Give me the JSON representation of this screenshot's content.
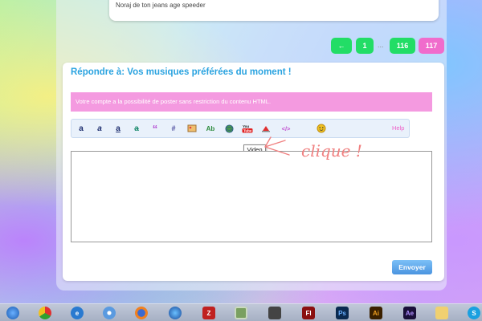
{
  "previous_post": {
    "text": "Noraj de ton jeans age speeder"
  },
  "pagination": {
    "prev_label": "←",
    "first_label": "1",
    "ellipsis": "...",
    "page_116": "116",
    "current_page": "117"
  },
  "reply_form": {
    "title": "Répondre à: Vos musiques préférées du moment !",
    "notice": "Votre compte a la possibilité de poster sans restriction du contenu HTML.",
    "toolbar": {
      "buttons": [
        {
          "name": "bold",
          "glyph": "a"
        },
        {
          "name": "italic",
          "glyph": "a"
        },
        {
          "name": "underline",
          "glyph": "a"
        },
        {
          "name": "strike",
          "glyph": "a"
        },
        {
          "name": "quote",
          "glyph": "“"
        },
        {
          "name": "spoiler",
          "glyph": "#"
        },
        {
          "name": "image",
          "glyph": "img"
        },
        {
          "name": "font",
          "glyph": "Ab"
        },
        {
          "name": "link",
          "glyph": "globe"
        },
        {
          "name": "video",
          "glyph": "YouTube"
        },
        {
          "name": "flash",
          "glyph": "flash"
        },
        {
          "name": "code",
          "glyph": "</>"
        },
        {
          "name": "smiley",
          "glyph": "smiley"
        }
      ],
      "help_label": "Help"
    },
    "tooltip": "Video",
    "message_value": "",
    "send_label": "Envoyer"
  },
  "annotation": {
    "text": "clique !",
    "color": "#f08080"
  },
  "taskbar": {
    "apps": [
      "start-orb",
      "chrome",
      "internet-explorer",
      "safari",
      "firefox",
      "windows-media",
      "filezilla",
      "paint",
      "pixel-app",
      "flash",
      "photoshop",
      "illustrator",
      "after-effects",
      "folder",
      "skype"
    ],
    "labels": {
      "flash": "Fl",
      "photoshop": "Ps",
      "illustrator": "Ai",
      "after_effects": "Ae"
    }
  }
}
